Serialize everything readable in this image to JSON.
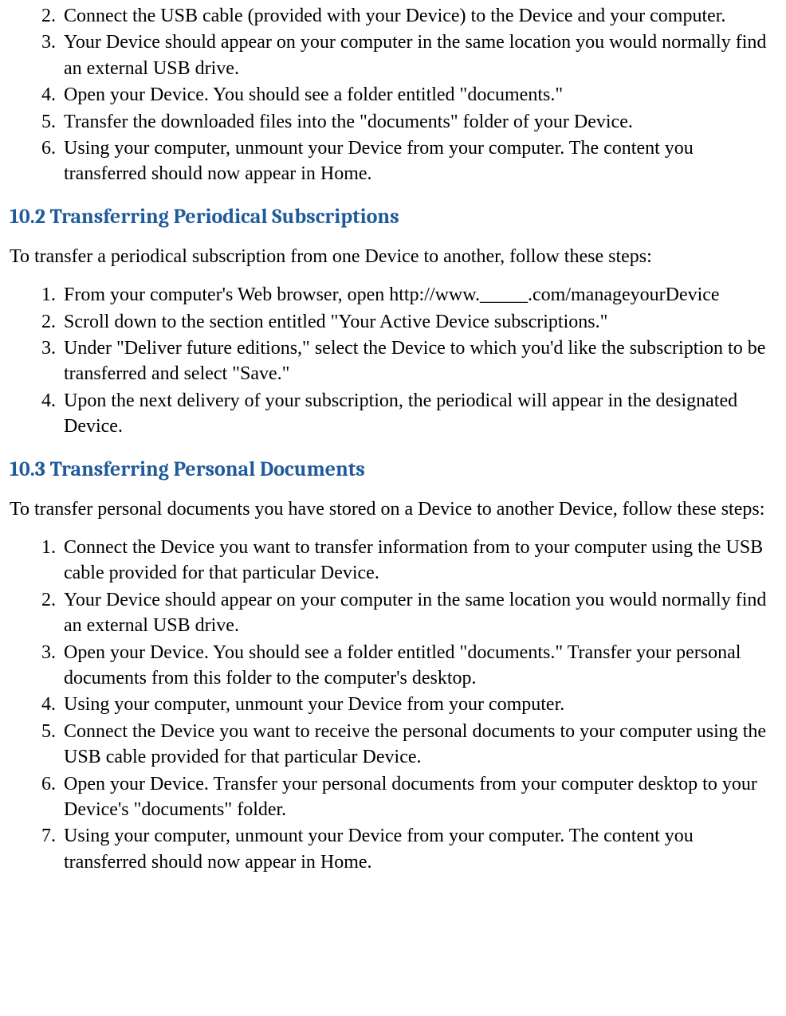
{
  "section10_1": {
    "list_start": 2,
    "items": [
      "Connect the USB cable (provided with your Device) to the Device and your computer.",
      "Your Device should appear on your computer in the same location you would normally find an external USB drive.",
      "Open your Device. You should see a folder entitled \"documents.\"",
      "Transfer the downloaded files into the \"documents\" folder of your Device.",
      "Using your computer, unmount your Device from your computer. The content you transferred should now appear in Home."
    ]
  },
  "section10_2": {
    "heading": "10.2 Transferring Periodical Subscriptions",
    "intro": "To transfer a periodical subscription from one Device to another, follow these steps:",
    "list_start": 1,
    "items": [
      "From your computer's Web browser, open http://www._____.com/manageyourDevice",
      "Scroll down to the section entitled \"Your Active Device subscriptions.\"",
      "Under \"Deliver future editions,\" select the Device to which you'd like the subscription to be transferred and select \"Save.\"",
      "Upon the next delivery of your subscription, the periodical will appear in the designated Device."
    ]
  },
  "section10_3": {
    "heading": "10.3 Transferring Personal Documents",
    "intro": "To transfer personal documents you have stored on a Device to another Device, follow these steps:",
    "list_start": 1,
    "items": [
      "Connect the Device you want to transfer information from to your computer using the USB cable provided for that particular Device.",
      "Your Device should appear on your computer in the same location you would normally find an external USB drive.",
      "Open your Device. You should see a folder entitled \"documents.\" Transfer your personal documents from this folder to the computer's desktop.",
      "Using your computer, unmount your Device from your computer.",
      "Connect the Device you want to receive the personal documents to your computer using the USB cable provided for that particular Device.",
      "Open your Device. Transfer your personal documents from your computer desktop to your Device's \"documents\" folder.",
      "Using your computer, unmount your Device from your computer. The content you transferred should now appear in Home."
    ]
  }
}
